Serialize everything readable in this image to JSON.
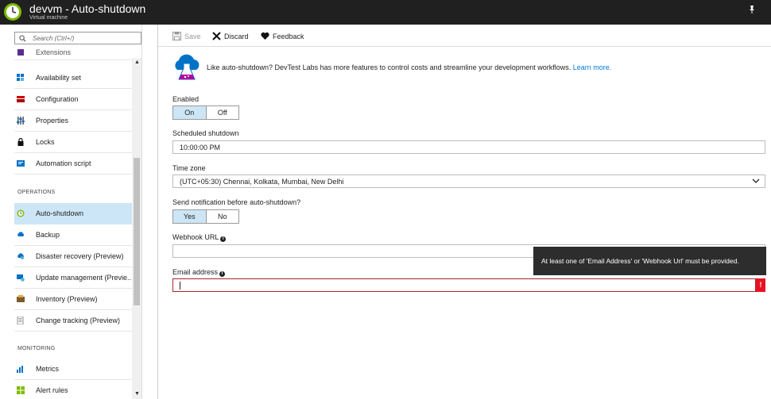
{
  "window": {
    "title": "devvm - Auto-shutdown",
    "subtitle": "Virtual machine"
  },
  "sidebar": {
    "search_placeholder": "Search (Ctrl+/)",
    "items": [
      {
        "label": "Extensions",
        "icon": "extensions-icon"
      },
      {
        "label": "Availability set",
        "icon": "availability-set-icon"
      },
      {
        "label": "Configuration",
        "icon": "configuration-icon"
      },
      {
        "label": "Properties",
        "icon": "properties-icon"
      },
      {
        "label": "Locks",
        "icon": "lock-icon"
      },
      {
        "label": "Automation script",
        "icon": "automation-script-icon"
      },
      {
        "label": "Auto-shutdown",
        "icon": "clock-icon"
      },
      {
        "label": "Backup",
        "icon": "backup-icon"
      },
      {
        "label": "Disaster recovery (Preview)",
        "icon": "disaster-recovery-icon"
      },
      {
        "label": "Update management (Previe...",
        "icon": "update-management-icon"
      },
      {
        "label": "Inventory (Preview)",
        "icon": "inventory-icon"
      },
      {
        "label": "Change tracking (Preview)",
        "icon": "change-tracking-icon"
      },
      {
        "label": "Metrics",
        "icon": "metrics-icon"
      },
      {
        "label": "Alert rules",
        "icon": "alert-rules-icon"
      }
    ],
    "sections": {
      "operations": "OPERATIONS",
      "monitoring": "MONITORING"
    }
  },
  "toolbar": {
    "save_label": "Save",
    "discard_label": "Discard",
    "feedback_label": "Feedback"
  },
  "banner": {
    "text": "Like auto-shutdown? DevTest Labs has more features to control costs and streamline your development workflows.",
    "link": "Learn more."
  },
  "form": {
    "enabled_label": "Enabled",
    "enabled_on": "On",
    "enabled_off": "Off",
    "scheduled_label": "Scheduled shutdown",
    "scheduled_value": "10:00:00 PM",
    "timezone_label": "Time zone",
    "timezone_value": "(UTC+05:30) Chennai, Kolkata, Mumbai, New Delhi",
    "notify_label": "Send notification before auto-shutdown?",
    "notify_yes": "Yes",
    "notify_no": "No",
    "webhook_label": "Webhook URL",
    "webhook_value": "",
    "email_label": "Email address",
    "email_value": "",
    "error_icon": "!",
    "tooltip": "At least one of 'Email Address' or 'Webhook Url' must be provided."
  },
  "colors": {
    "titlebar": "#202020",
    "accent": "#0078d4",
    "selected": "#cde6f7",
    "error": "#e81123"
  }
}
